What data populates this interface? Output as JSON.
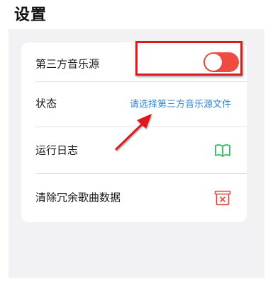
{
  "page": {
    "title": "设置"
  },
  "settings": {
    "third_party_source": {
      "label": "第三方音乐源",
      "toggle_on": true,
      "accent_color": "#f04b41"
    },
    "status": {
      "label": "状态",
      "link_text": "请选择第三方音乐源文件",
      "link_color": "#2f86d8"
    },
    "run_log": {
      "label": "运行日志",
      "icon": "book-icon",
      "icon_color": "#2dbb57"
    },
    "clear_data": {
      "label": "清除冗余歌曲数据",
      "icon": "trash-box-icon",
      "icon_color": "#e2493c"
    }
  },
  "annotations": {
    "highlight_color": "#e0191b"
  }
}
